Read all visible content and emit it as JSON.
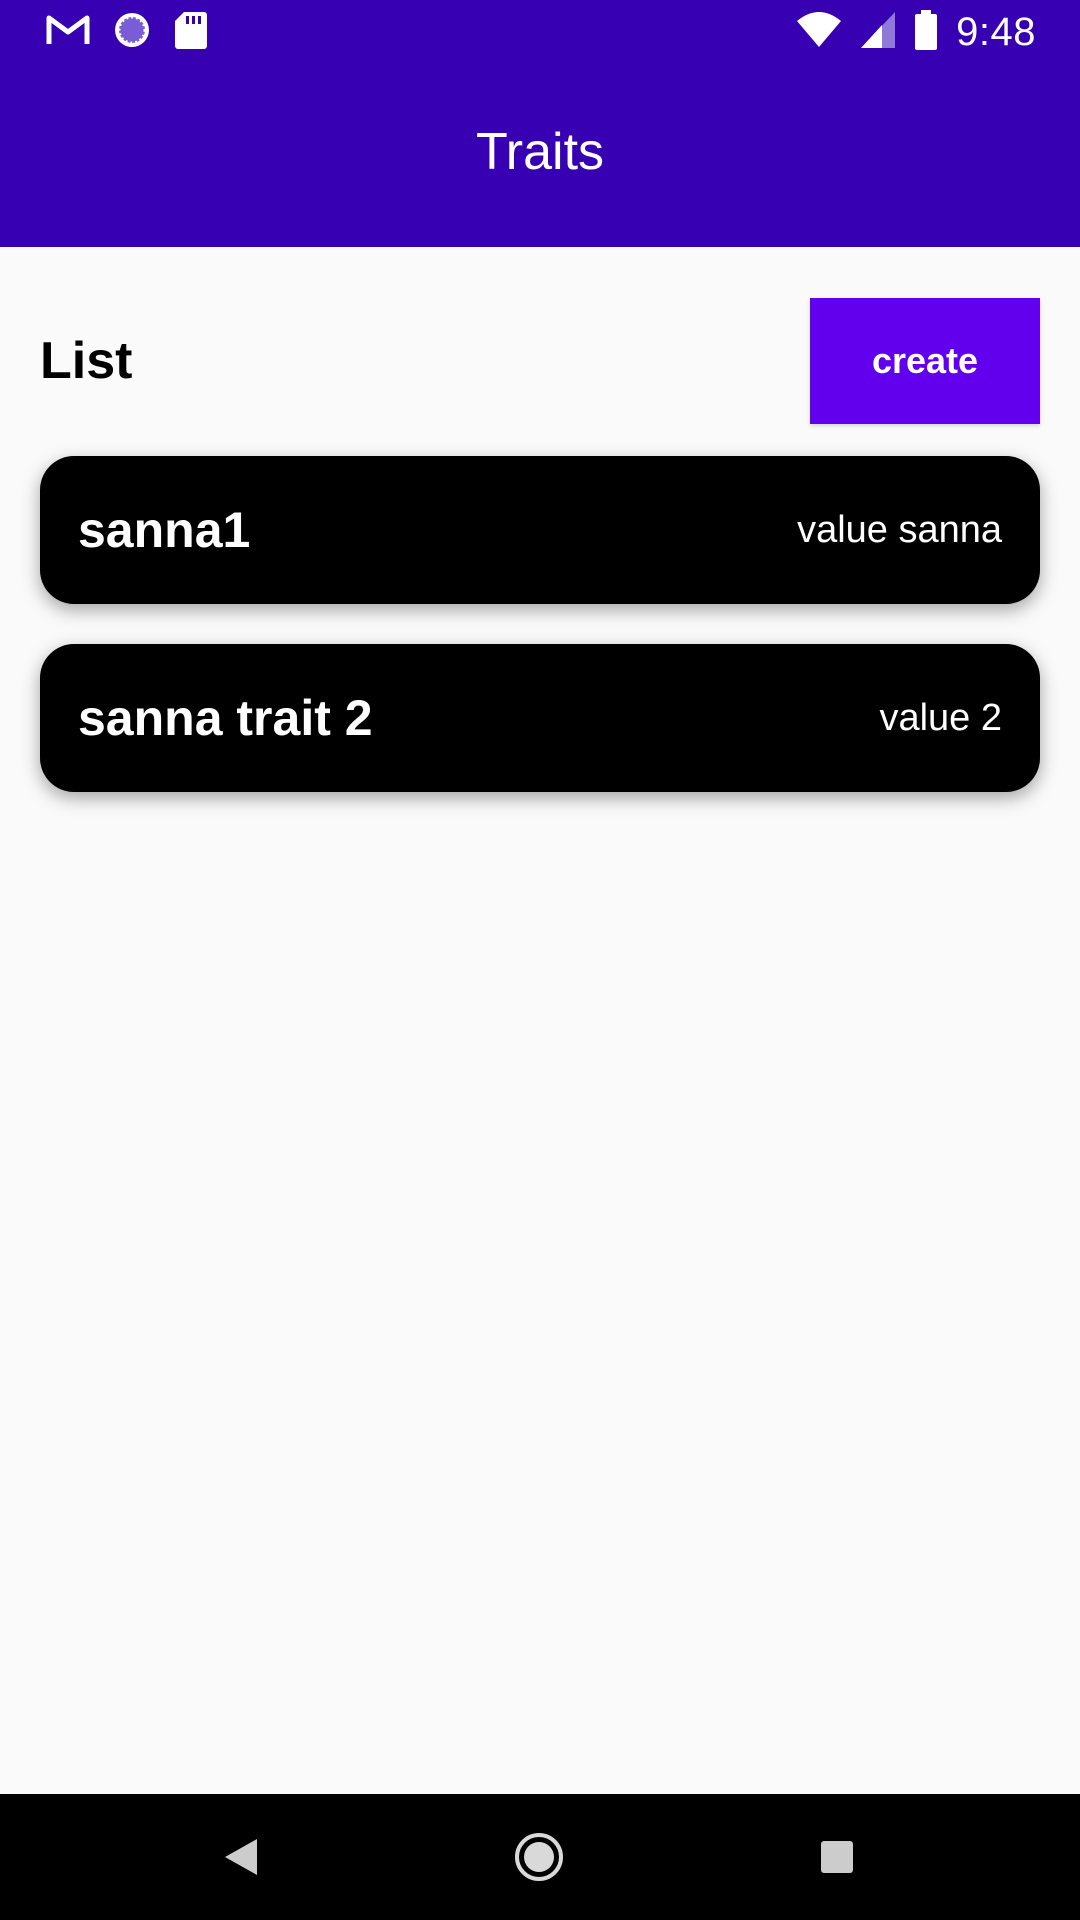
{
  "status_bar": {
    "time": "9:48",
    "icons_left": [
      "gmail-icon",
      "sync-icon",
      "sd-card-icon"
    ],
    "icons_right": [
      "wifi-icon",
      "cell-signal-icon",
      "battery-icon"
    ]
  },
  "app_bar": {
    "title": "Traits"
  },
  "list_section": {
    "title": "List",
    "create_label": "create"
  },
  "traits": [
    {
      "name": "sanna1",
      "value": "value sanna"
    },
    {
      "name": "sanna trait 2",
      "value": "value 2"
    }
  ],
  "nav_bar": {
    "buttons": [
      "back-icon",
      "home-icon",
      "recents-icon"
    ]
  },
  "colors": {
    "primary_dark": "#3700b3",
    "primary": "#6200ee",
    "background": "#fafafa",
    "card": "#000000"
  }
}
